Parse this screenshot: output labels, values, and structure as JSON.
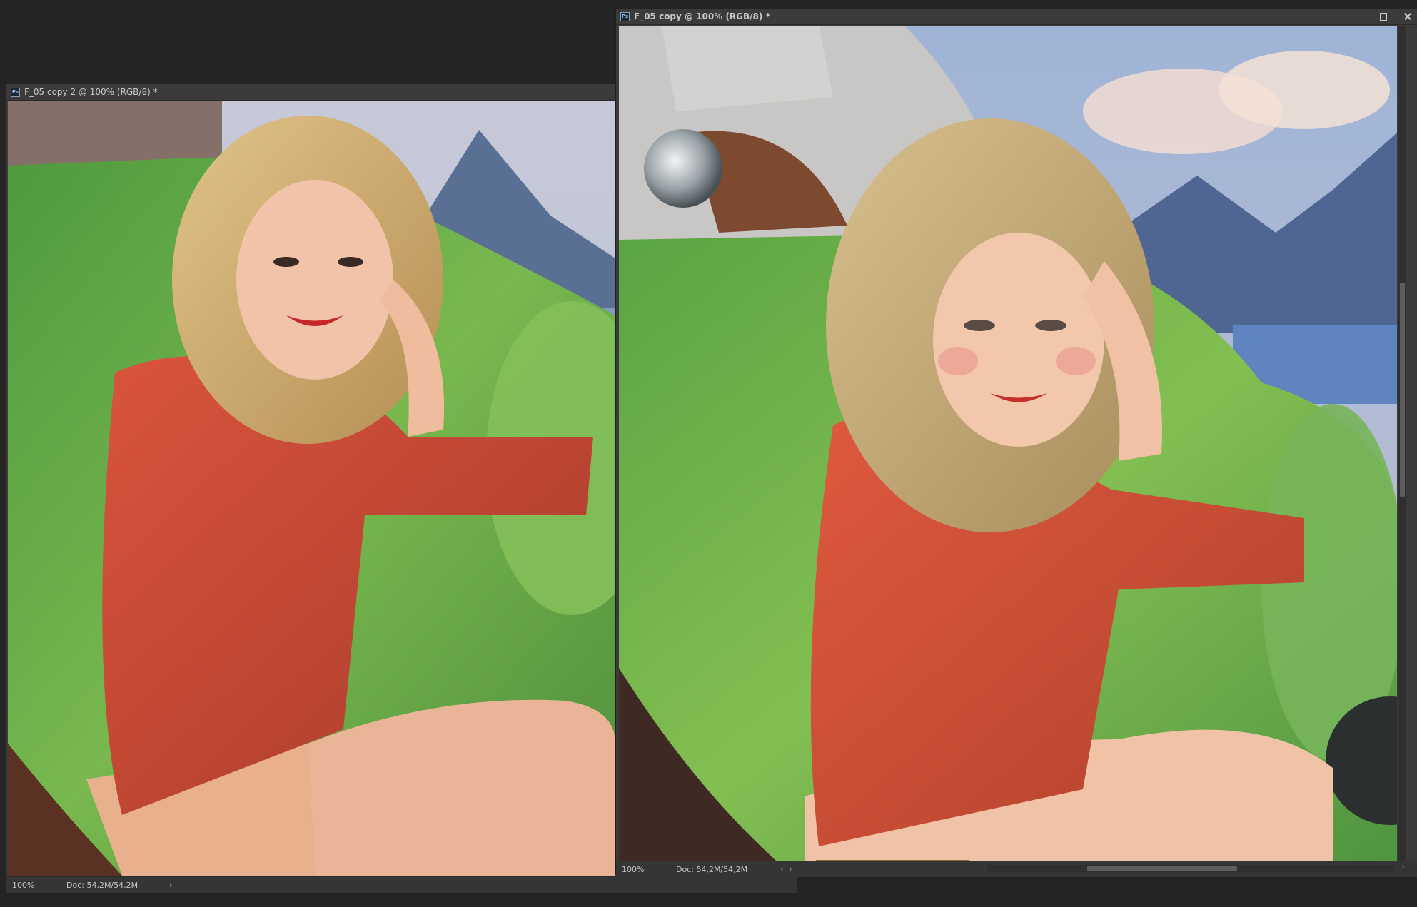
{
  "windows": {
    "left": {
      "title": "F_05 copy 2 @ 100% (RGB/8) *",
      "zoom": "100%",
      "doc_info": "Doc: 54,2M/54,2M",
      "icon": "ps-icon",
      "image_description_label": ""
    },
    "right": {
      "title": "F_05 copy @ 100% (RGB/8) *",
      "zoom": "100%",
      "doc_info": "Doc: 54,2M/54,2M",
      "icon": "ps-icon"
    }
  },
  "colors": {
    "workspace_bg": "#242424",
    "panel": "#3a3a3a",
    "car_green": "#6aa84a",
    "dress_red": "#c94a35",
    "hair_blonde": "#cfae72",
    "sky": "#b9c6d8",
    "mountain": "#566e94"
  }
}
